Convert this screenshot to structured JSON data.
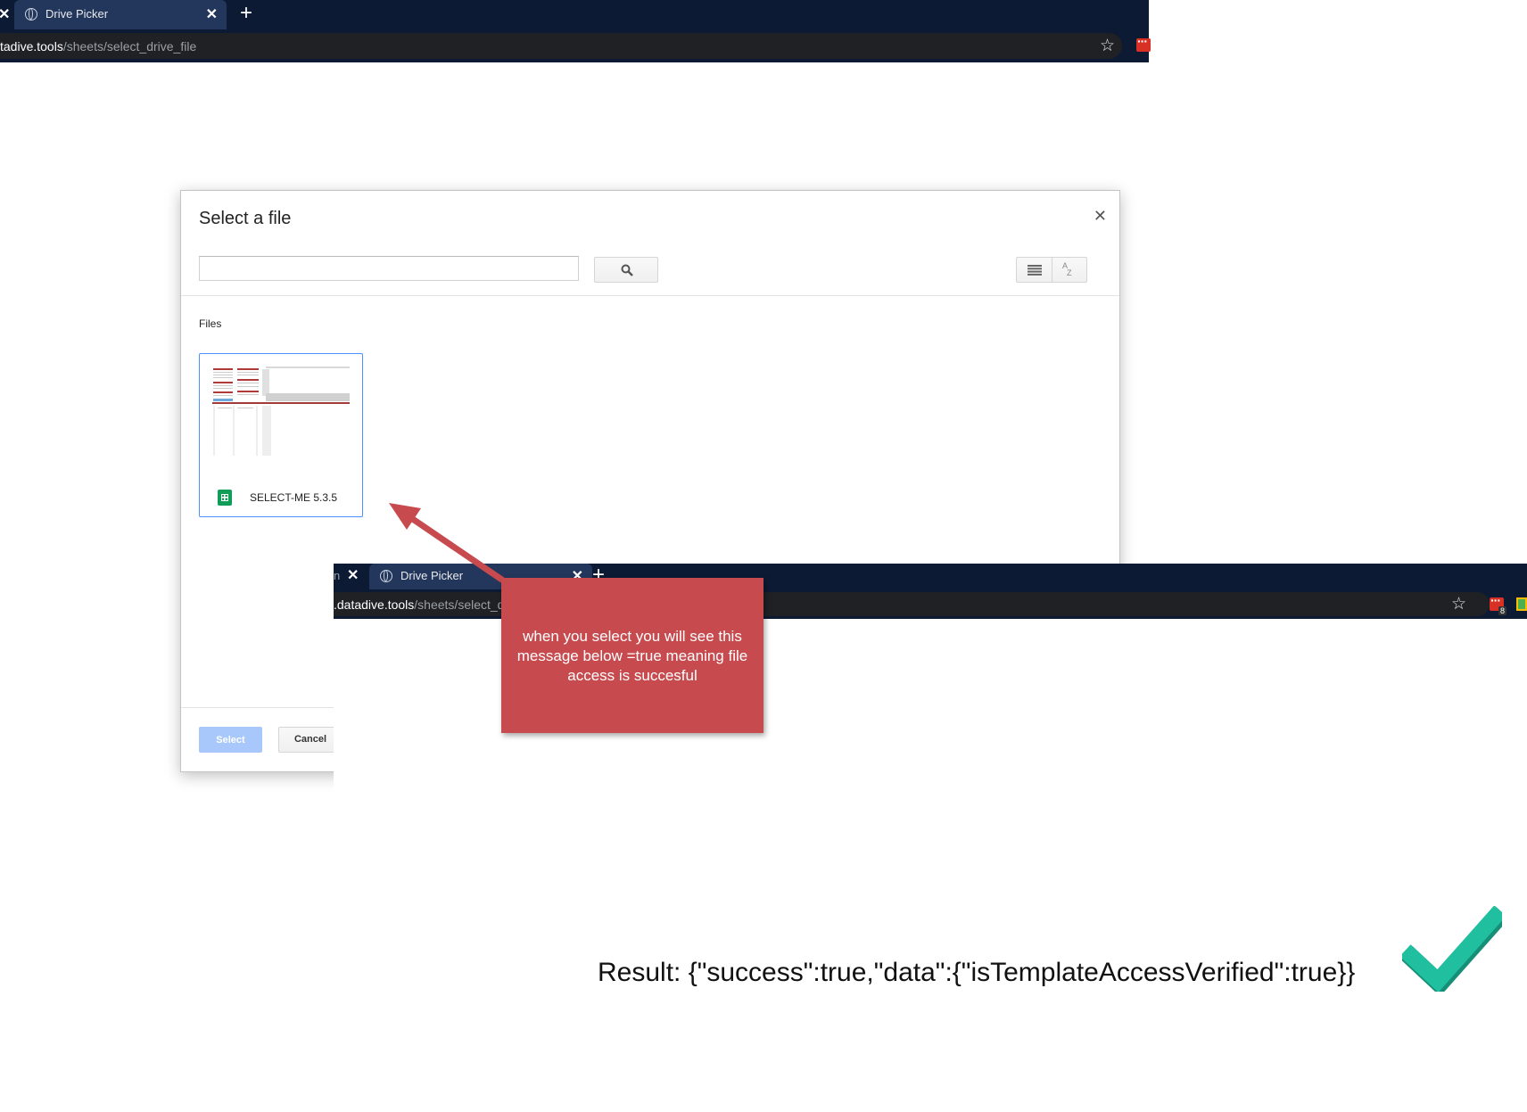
{
  "browser_top": {
    "tab_title": "Drive Picker",
    "url_host": "tadive.tools",
    "url_path": "/sheets/select_drive_file"
  },
  "browser_bottom": {
    "tab_partial_text": "n",
    "tab_title": "Drive Picker",
    "url_host": ".datadive.tools",
    "url_path": "/sheets/select_d",
    "extension_badge": "8"
  },
  "dialog": {
    "title": "Select a file",
    "search_value": "",
    "section_label": "Files",
    "file": {
      "name": "SELECT-ME 5.3.5",
      "type_icon": "google-sheets-icon"
    },
    "select_label": "Select",
    "cancel_label": "Cancel"
  },
  "callout": {
    "text": "when you select you will see this message below =true meaning file access is succesful",
    "color": "#c64a4e"
  },
  "result": {
    "text": "Result: {\"success\":true,\"data\":{\"isTemplateAccessVerified\":true}}"
  },
  "colors": {
    "chrome_bg": "#0d1a33",
    "accent_blue": "#4d90fe",
    "check_green": "#1fbfa0"
  }
}
